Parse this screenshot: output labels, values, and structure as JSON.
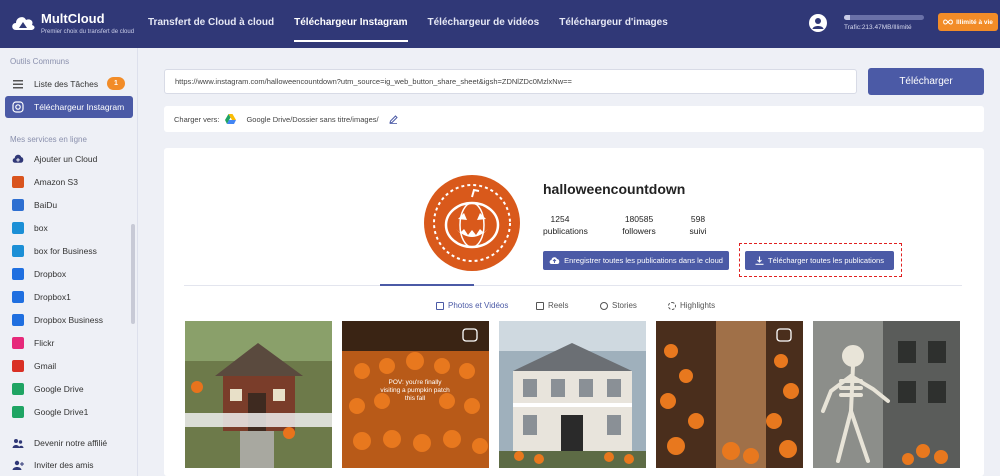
{
  "app": {
    "name": "MultCloud",
    "tagline": "Premier choix du transfert de cloud"
  },
  "nav": [
    {
      "label": "Transfert de Cloud à cloud",
      "active": false
    },
    {
      "label": "Téléchargeur Instagram",
      "active": true
    },
    {
      "label": "Téléchargeur de vidéos",
      "active": false
    },
    {
      "label": "Téléchargeur d'images",
      "active": false
    }
  ],
  "header": {
    "traffic_text": "Trafic:213.47MB/Illimité",
    "traffic_fraction": 0.08,
    "upgrade_label": "Illimité à vie"
  },
  "sidebar": {
    "section1": "Outils Communs",
    "task_list": "Liste des Tâches",
    "task_badge": "1",
    "instagram": "Téléchargeur Instagram",
    "section2": "Mes services en ligne",
    "add_cloud": "Ajouter un Cloud",
    "services": [
      {
        "label": "Amazon S3",
        "color": "#d9541e"
      },
      {
        "label": "BaiDu",
        "color": "#2e6fd1"
      },
      {
        "label": "box",
        "color": "#1b8fd6"
      },
      {
        "label": "box for Business",
        "color": "#1b8fd6"
      },
      {
        "label": "Dropbox",
        "color": "#1f6fe0"
      },
      {
        "label": "Dropbox1",
        "color": "#1f6fe0"
      },
      {
        "label": "Dropbox Business",
        "color": "#1f6fe0"
      },
      {
        "label": "Flickr",
        "color": "#e6297a"
      },
      {
        "label": "Gmail",
        "color": "#d93025"
      },
      {
        "label": "Google Drive",
        "color": "#1fa463"
      },
      {
        "label": "Google Drive1",
        "color": "#1fa463"
      }
    ],
    "affiliate": "Devenir notre affilié",
    "invite": "Inviter des amis"
  },
  "download": {
    "url_value": "https://www.instagram.com/halloweencountdown?utm_source=ig_web_button_share_sheet&igsh=ZDNlZDc0MzlxNw==",
    "button": "Télécharger",
    "save_label": "Charger vers:",
    "save_path": "Google Drive/Dossier sans titre/images/"
  },
  "profile": {
    "username": "halloweencountdown",
    "stats": [
      {
        "value": "1254",
        "label": "publications"
      },
      {
        "value": "180585",
        "label": "followers"
      },
      {
        "value": "598",
        "label": "suivi"
      }
    ],
    "save_all_cloud": "Enregistrer toutes les publications dans le cloud",
    "download_all": "Télécharger toutes les publications"
  },
  "tabs": [
    {
      "label": "Photos et Vidéos",
      "active": true
    },
    {
      "label": "Reels",
      "active": false
    },
    {
      "label": "Stories",
      "active": false
    },
    {
      "label": "Highlights",
      "active": false
    }
  ],
  "posts": [
    {
      "overlay": ""
    },
    {
      "overlay": "POV: you're finally visiting a pumpkin patch this fall"
    },
    {
      "overlay": ""
    },
    {
      "overlay": ""
    },
    {
      "overlay": ""
    }
  ],
  "colors": {
    "nav_bg": "#303877",
    "accent": "#4b5aa6",
    "orange": "#f28c28",
    "highlight": "#e02020"
  }
}
